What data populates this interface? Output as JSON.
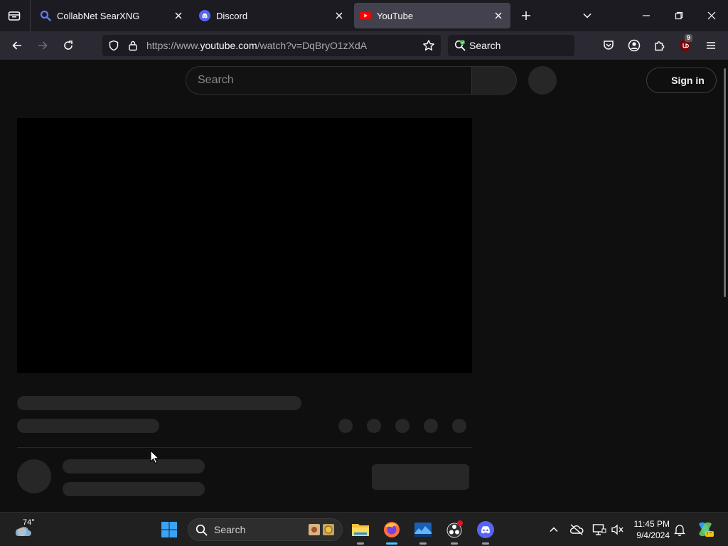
{
  "browser": {
    "tabs": [
      {
        "title": "CollabNet SearXNG",
        "icon": "search-favicon",
        "active": false
      },
      {
        "title": "Discord",
        "icon": "discord-favicon",
        "active": false
      },
      {
        "title": "YouTube",
        "icon": "youtube-favicon",
        "active": true
      }
    ],
    "url_prefix": "https://www.",
    "url_host": "youtube.com",
    "url_path": "/watch?v=DqBryO1zXdA",
    "search_label": "Search",
    "extension_badge": "9"
  },
  "youtube": {
    "search_placeholder": "Search",
    "signin_label": "Sign in"
  },
  "taskbar": {
    "weather_temp": "74°",
    "search_label": "Search",
    "time": "11:45 PM",
    "date": "9/4/2024",
    "apps": [
      "file-explorer",
      "firefox",
      "photos",
      "obs-studio",
      "discord"
    ]
  },
  "colors": {
    "page_bg": "#0f0f0f",
    "skeleton": "#272727",
    "browser_tab_bg": "#1c1b22",
    "browser_nav_bg": "#2b2a33",
    "active_tab": "#42414d",
    "youtube_red": "#ff0000",
    "discord_blurple": "#5865f2"
  }
}
